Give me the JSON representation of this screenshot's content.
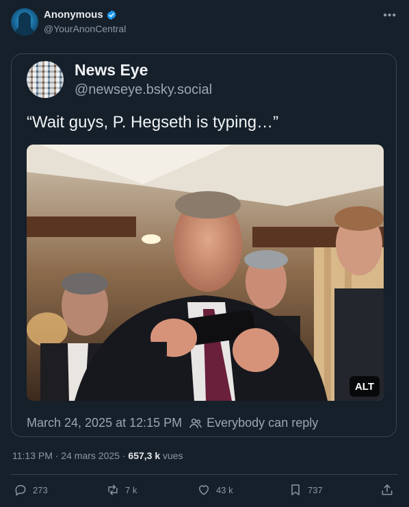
{
  "author": {
    "display_name": "Anonymous",
    "handle": "@YourAnonCentral",
    "more_glyph": "•••"
  },
  "quoted": {
    "name": "News Eye",
    "handle": "@newseye.bsky.social",
    "text": "“Wait guys, P. Hegseth is typing…”",
    "alt_label": "ALT",
    "date": "March 24, 2025 at 12:15 PM",
    "reply_setting": "Everybody can reply"
  },
  "meta": {
    "time": "11:13 PM",
    "separator": "·",
    "date": "24 mars 2025",
    "views_count": "657,3 k",
    "views_label": "vues"
  },
  "actions": {
    "replies": "273",
    "reposts": "7 k",
    "likes": "43 k",
    "bookmarks": "737"
  },
  "colors": {
    "background": "#15202b",
    "border": "#38444d",
    "muted_text": "#8b98a5",
    "verified_blue": "#1d9bf0"
  },
  "icons": [
    "verified-badge-icon",
    "more-icon",
    "people-icon",
    "reply-icon",
    "repost-icon",
    "like-icon",
    "bookmark-icon",
    "share-icon"
  ]
}
